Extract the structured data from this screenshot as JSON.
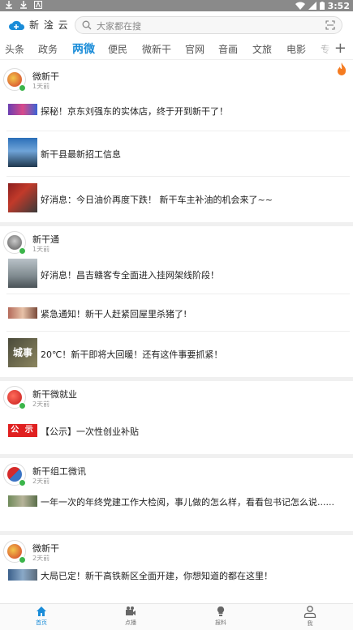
{
  "status_bar": {
    "time": "3:52"
  },
  "header": {
    "logo_text": "新 淦 云",
    "search_placeholder": "大家都在搜"
  },
  "tabs": [
    "头条",
    "政务",
    "两微",
    "便民",
    "微新干",
    "官网",
    "音画",
    "文旅",
    "电影",
    "专"
  ],
  "active_tab": "两微",
  "feed": [
    {
      "source": "微新干",
      "time": "1天前",
      "items": [
        "探秘！京东刘强东的实体店，终于开到新干了！",
        "新干县最新招工信息",
        "好消息：今日油价再度下跌！ 新干车主补油的机会来了~~"
      ]
    },
    {
      "source": "新干通",
      "time": "1天前",
      "items": [
        "好消息！昌吉赣客专全面进入挂网架线阶段！",
        "紧急通知！新干人赶紧回屋里杀猪了!",
        "20℃！新干即将大回暖！还有这件事要抓紧！"
      ]
    },
    {
      "source": "新干微就业",
      "time": "2天前",
      "notice_badge": "公 示",
      "items": [
        "【公示】一次性创业补贴"
      ]
    },
    {
      "source": "新干组工微讯",
      "time": "2天前",
      "items": [
        "一年一次的年终党建工作大检阅，事儿做的怎么样，看看包书记怎么说......"
      ]
    },
    {
      "source": "微新干",
      "time": "2天前",
      "items": [
        "大局已定！新干高铁新区全面开建，你想知道的都在这里！"
      ]
    }
  ],
  "thumb_text": "城事",
  "bottom_nav": [
    {
      "label": "首页",
      "icon": "home-icon"
    },
    {
      "label": "点播",
      "icon": "video-icon"
    },
    {
      "label": "报料",
      "icon": "bulb-icon"
    },
    {
      "label": "我",
      "icon": "person-icon"
    }
  ],
  "colors": {
    "accent": "#1a8cd8",
    "notice_red": "#e02020",
    "verified_green": "#3bb54a"
  }
}
